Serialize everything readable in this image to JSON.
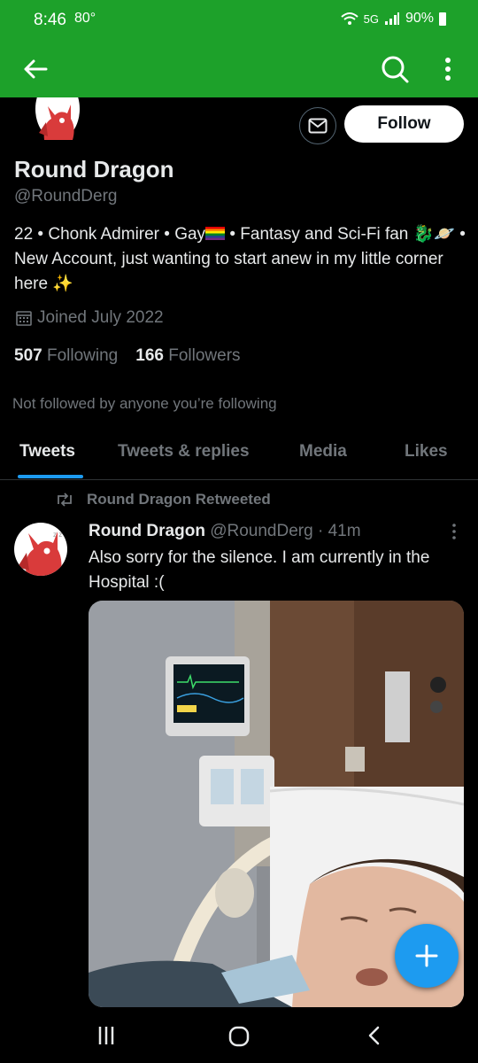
{
  "status_bar": {
    "time": "8:46",
    "temp": "80°",
    "network": "5G",
    "battery": "90%"
  },
  "app_bar": {
    "back_icon": "arrow-left-icon",
    "search_icon": "search-icon",
    "more_icon": "more-vertical-icon"
  },
  "profile": {
    "display_name": "Round Dragon",
    "handle": "@RoundDerg",
    "follow_label": "Follow",
    "bio_part1": "22 • Chonk Admirer • Gay",
    "bio_part2": " • Fantasy and Sci-Fi fan ",
    "bio_emoji": "🐉🪐",
    "bio_part3": " • New Account, just wanting to start anew in my little corner here ",
    "bio_sparkle": "✨",
    "joined": "Joined July 2022",
    "following_count": "507",
    "following_label": "Following",
    "followers_count": "166",
    "followers_label": "Followers",
    "not_followed": "Not followed by anyone you’re following"
  },
  "tabs": [
    {
      "label": "Tweets",
      "active": true
    },
    {
      "label": "Tweets & replies",
      "active": false
    },
    {
      "label": "Media",
      "active": false
    },
    {
      "label": "Likes",
      "active": false
    }
  ],
  "tweet": {
    "retweet_label": "Round Dragon Retweeted",
    "author_name": "Round Dragon",
    "author_handle": "@RoundDerg",
    "time": " · 41m",
    "text": "Also sorry for the silence. I am currently in the Hospital :("
  },
  "colors": {
    "accent": "#1d9bf0",
    "app_bar": "#1da12a",
    "background": "#000000",
    "muted": "#71767b"
  }
}
